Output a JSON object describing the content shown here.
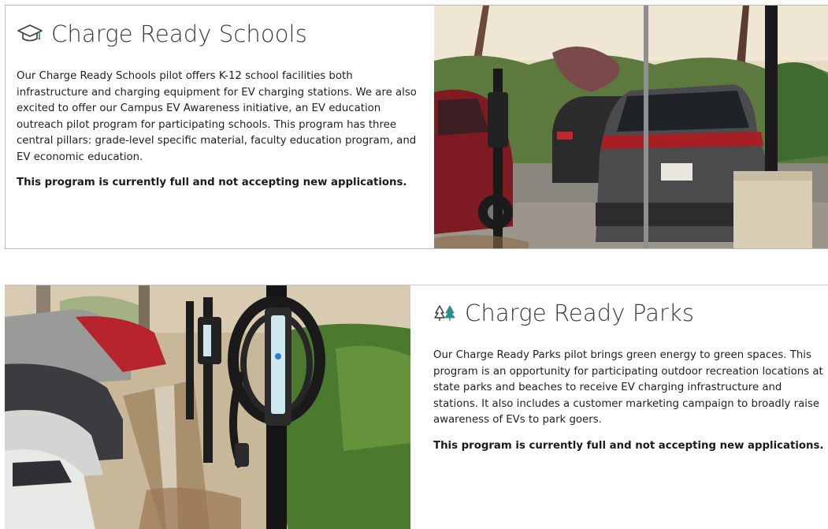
{
  "schools": {
    "icon": "graduation-cap-icon",
    "title": "Charge Ready Schools",
    "body": "Our Charge Ready Schools pilot offers K-12 school facilities both infrastructure and charging equipment for EV charging stations. We are also excited to offer our Campus EV Awareness initiative, an EV education outreach pilot program for participating schools. This program has three central pillars: grade-level specific material, faculty education program, and EV economic education.",
    "note": "This program is currently full and not accepting new applications.",
    "photo": "cars-parked-at-school-ev-charger-photo"
  },
  "parks": {
    "icon": "trees-icon",
    "title": "Charge Ready Parks",
    "body": "Our Charge Ready Parks pilot brings green energy to green spaces. This program is an opportunity for participating outdoor recreation locations at state parks and beaches to receive EV charging infrastructure and stations. It also includes a customer marketing campaign to broadly raise awareness of EVs to park goers.",
    "note": "This program is currently full and not accepting new applications.",
    "photo": "ev-charging-station-in-parking-lot-photo"
  },
  "colors": {
    "icon_teal": "#2a8c8c",
    "text": "#1f1f1f",
    "border": "#b9b9b9"
  }
}
